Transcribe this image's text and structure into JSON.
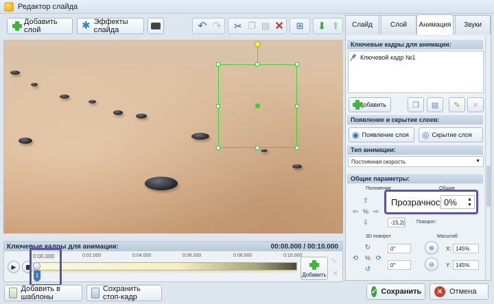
{
  "window": {
    "title": "Редактор слайда"
  },
  "toolbar": {
    "add_layer_label": "Добавить слой",
    "slide_effects_label": "Эффекты слайда"
  },
  "tabs": [
    {
      "label": "Слайд",
      "active": false
    },
    {
      "label": "Слой",
      "active": false
    },
    {
      "label": "Анимация",
      "active": true
    },
    {
      "label": "Звуки",
      "active": false
    }
  ],
  "keyframes_section": {
    "title": "Ключевые кадры для анимации:",
    "items": [
      "Ключевой кадр №1"
    ],
    "add_label": "Добавить"
  },
  "visibility_section": {
    "title": "Появление и скрытие слоев:",
    "show_label": "Появление слоя",
    "hide_label": "Скрытие слоя"
  },
  "animation_type_section": {
    "title": "Тип анимации:",
    "selected": "Постоянная скорость"
  },
  "general_section": {
    "title": "Общие параметры:",
    "position_label": "Положение",
    "general_label": "Общие",
    "position_value": "-15,2(",
    "rotation_label": "Поворот:",
    "rotation_3d_label": "3D поворот",
    "rot3d_x": "0°",
    "rot3d_y": "0°",
    "scale_label": "Масштаб",
    "scale_x_label": "X:",
    "scale_x": "145%",
    "scale_y_label": "Y:",
    "scale_y": "145%"
  },
  "opacity_callout": {
    "label": "Прозрачность:",
    "value": "0%"
  },
  "timeline": {
    "title": "Ключевые кадры для анимации:",
    "time_range": "00:00.000 / 00:10.000",
    "current_time": "0:00.000",
    "ticks": [
      "0:02.000",
      "0:04.000",
      "0:06.000",
      "0:08.000",
      "0:10.000"
    ],
    "marker_label": "1",
    "add_label": "Добавить"
  },
  "bottom": {
    "add_template_label": "Добавить в шаблоны",
    "save_frame_label": "Сохранить стоп-кадр",
    "save_label": "Сохранить",
    "cancel_label": "Отмена"
  },
  "colors": {
    "accent": "#5a4fb6",
    "selection": "#36d436",
    "save_green": "#3aa43a",
    "cancel_red": "#d23a2a"
  }
}
